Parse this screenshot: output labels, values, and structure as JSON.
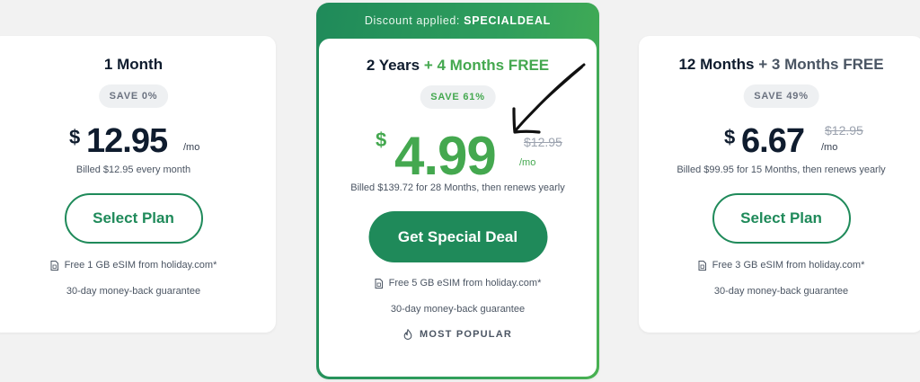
{
  "plans": {
    "left": {
      "title": "1 Month",
      "save_badge": "SAVE 0%",
      "currency": "$",
      "price": "12.95",
      "per": "/mo",
      "billed": "Billed $12.95 every month",
      "button_label": "Select Plan",
      "esim": "Free 1 GB eSIM from holiday.com*",
      "guarantee": "30-day money-back guarantee"
    },
    "center": {
      "discount_prefix": "Discount applied:",
      "discount_code": "SPECIALDEAL",
      "title_main": "2 Years",
      "title_accent": "+ 4 Months FREE",
      "save_badge": "SAVE 61%",
      "currency": "$",
      "price": "4.99",
      "old_price": "$12.95",
      "per": "/mo",
      "billed": "Billed $139.72 for 28 Months, then renews yearly",
      "button_label": "Get Special Deal",
      "esim": "Free 5 GB eSIM from holiday.com*",
      "guarantee": "30-day money-back guarantee",
      "popular": "MOST POPULAR"
    },
    "right": {
      "title_main": "12 Months",
      "title_muted": "+ 3 Months FREE",
      "save_badge": "SAVE 49%",
      "currency": "$",
      "price": "6.67",
      "old_price": "$12.95",
      "per": "/mo",
      "billed": "Billed $99.95 for 15 Months, then renews yearly",
      "button_label": "Select Plan",
      "esim": "Free 3 GB eSIM from holiday.com*",
      "guarantee": "30-day money-back guarantee"
    }
  },
  "icons": {
    "esim": "sim-card-icon",
    "popular": "flame-icon",
    "highlight": "hand-drawn-arrow-icon"
  },
  "colors": {
    "brand_green": "#1f8a5a",
    "accent_green": "#44a84f",
    "price_text": "#0f1c2e",
    "background": "#f2f2f2"
  }
}
